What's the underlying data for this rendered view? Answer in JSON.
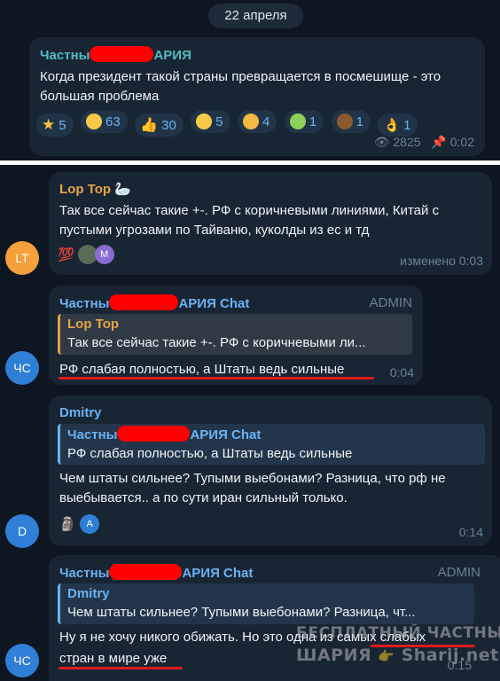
{
  "date_label": "22 апреля",
  "post": {
    "sender_prefix": "Частны",
    "sender_suffix": "АРИЯ",
    "text": "Когда президент такой страны превращается в посмешище - это большая проблема",
    "reactions": [
      {
        "icon": "star-icon",
        "count": "5"
      },
      {
        "icon": "grin-icon",
        "count": "63"
      },
      {
        "icon": "thumbs-up-icon",
        "count": "30"
      },
      {
        "icon": "slightly-frowning-icon",
        "count": "5"
      },
      {
        "icon": "thinking-icon",
        "count": "4"
      },
      {
        "icon": "nauseated-icon",
        "count": "1"
      },
      {
        "icon": "poop-icon",
        "count": "1"
      },
      {
        "icon": "ok-hand-icon",
        "count": "1"
      }
    ],
    "views": "2825",
    "time": "0:02"
  },
  "messages": {
    "m1": {
      "avatar": "LT",
      "avatar_color": "#f5a03a",
      "sender": "Lop Top",
      "sender_color": "#e6a547",
      "text": "Так все сейчас такие +-. РФ с коричневыми линиями, Китай с пустыми угрозами по Тайваню, куколды из ес и тд",
      "reaction_emoji": "💯",
      "reactor_initial": "M",
      "edited_time": "изменено 0:03"
    },
    "m2": {
      "avatar": "ЧС",
      "avatar_color": "#2f7fd6",
      "sender_prefix": "Частны",
      "sender_suffix": "АРИЯ Chat",
      "sender_color": "#6ab3f3",
      "badge": "ADMIN",
      "reply_sender": "Lop Top",
      "reply_text": "Так все сейчас такие +-. РФ с коричневыми ли...",
      "text": "РФ слабая полностью, а Штаты ведь сильные",
      "time": "0:04"
    },
    "m3": {
      "avatar": "D",
      "avatar_color": "#2f7fd6",
      "sender": "Dmitry",
      "sender_color": "#6ab3f3",
      "reply_sender_prefix": "Частны",
      "reply_sender_suffix": "АРИЯ Chat",
      "reply_text": "РФ слабая полностью, а Штаты ведь сильные",
      "text": "Чем штаты сильнее? Тупыми выебонами? Разница, что рф не выебывается.. а по сути иран сильный только.",
      "reaction_emoji": "🗿",
      "reactor_initial": "A",
      "time": "0:14"
    },
    "m4": {
      "avatar": "ЧС",
      "avatar_color": "#2f7fd6",
      "sender_prefix": "Частны",
      "sender_suffix": "АРИЯ Chat",
      "badge": "ADMIN",
      "reply_sender": "Dmitry",
      "reply_text": "Чем штаты сильнее? Тупыми выебонами? Разница, чт...",
      "text_line1": "Ну я не хочу никого обижать. Но это одна из самых слабых",
      "text_line2": "стран в мире уже",
      "time": "0:15"
    }
  },
  "watermark": {
    "line1": "БЕСПЛАТНЫЙ ЧАСТНЫЙ",
    "line2_left": "ШАРИЯ",
    "line2_right": "Sharij.net"
  }
}
